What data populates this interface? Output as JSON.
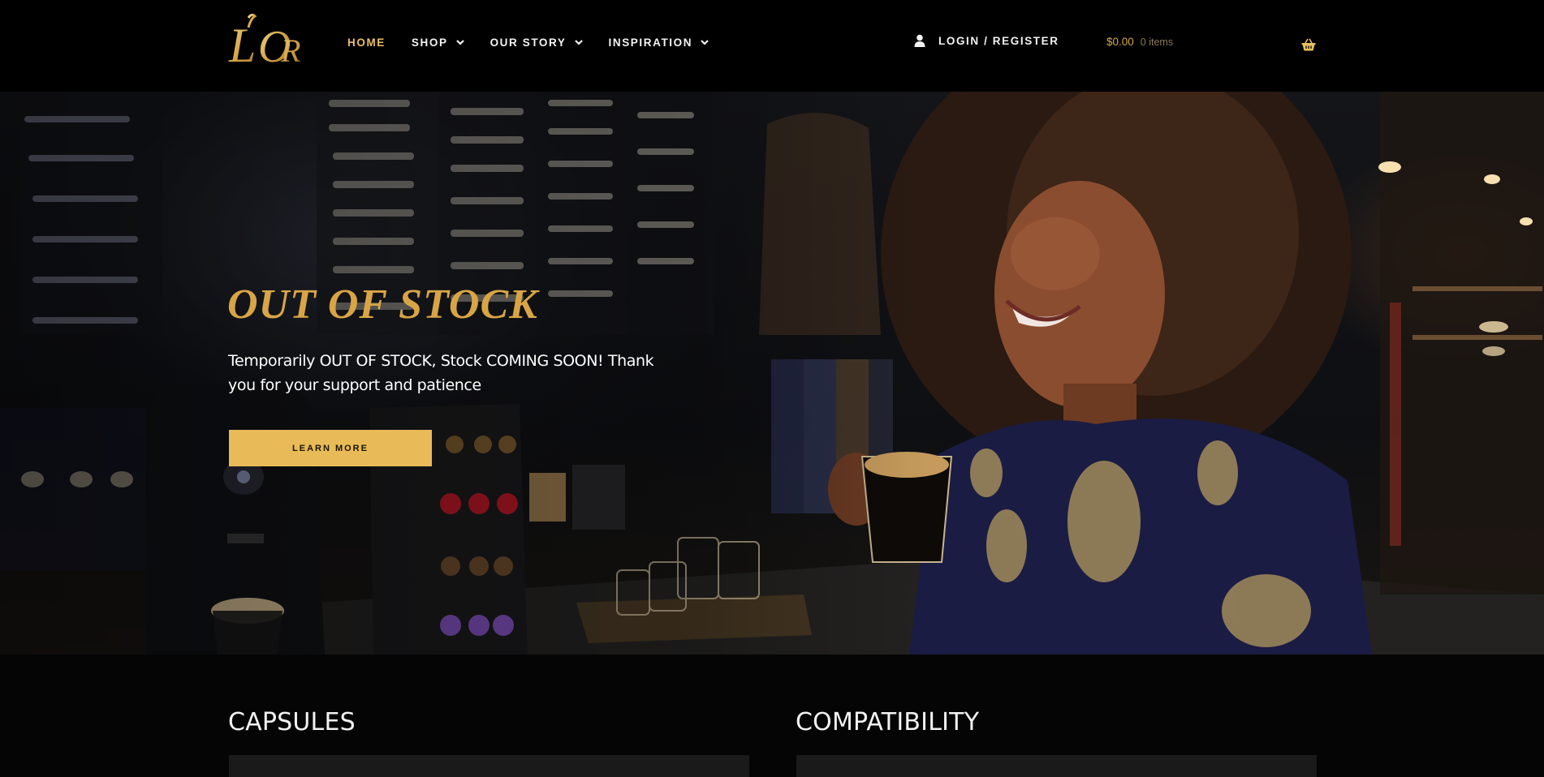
{
  "brand": {
    "logo_text": "L'OR",
    "accent_color": "#e9c060",
    "gold_color": "#d9a544"
  },
  "nav": {
    "items": [
      {
        "label": "HOME",
        "active": true,
        "has_dropdown": false
      },
      {
        "label": "SHOP",
        "active": false,
        "has_dropdown": true
      },
      {
        "label": "OUR STORY",
        "active": false,
        "has_dropdown": true
      },
      {
        "label": "INSPIRATION",
        "active": false,
        "has_dropdown": true
      }
    ]
  },
  "account": {
    "login_label": "LOGIN / REGISTER",
    "icon": "user-icon"
  },
  "cart": {
    "amount": "$0.00",
    "count": "0 items",
    "icon": "basket-icon"
  },
  "hero": {
    "title": "OUT OF STOCK",
    "text": "Temporarily OUT OF STOCK, Stock COMING SOON! Thank you for your support and patience",
    "button_label": "LEARN MORE",
    "button_color": "#e9bb58"
  },
  "sections": [
    {
      "title": "CAPSULES"
    },
    {
      "title": "COMPATIBILITY"
    }
  ]
}
